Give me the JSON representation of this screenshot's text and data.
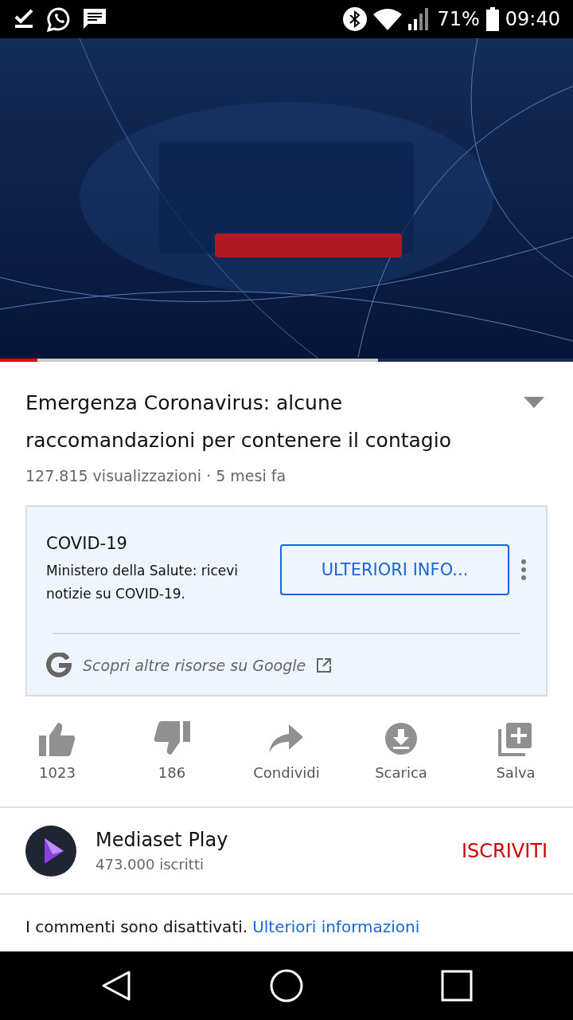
{
  "status_bar": {
    "battery_text": "71%",
    "time": "09:40"
  },
  "video": {
    "kind": "picture",
    "progress": {
      "level": 0.065
    },
    "buffer": {
      "level": 0.66
    }
  },
  "title": "Emergenza Coronavirus: alcune raccomandazioni per contenere il contagio",
  "meta": "127.815 visualizzazioni · 5 mesi fa",
  "info_card": {
    "heading": "COVID-19",
    "text": "Ministero della Salute: ricevi notizie su COVID-19.",
    "button": "ULTERIORI INFO...",
    "link": "Scopri altre risorse su Google"
  },
  "actions": [
    {
      "kind": "like",
      "label": "1023"
    },
    {
      "kind": "dislike",
      "label": "186"
    },
    {
      "kind": "share",
      "label": "Condividi"
    },
    {
      "kind": "download",
      "label": "Scarica"
    },
    {
      "kind": "save",
      "label": "Salva"
    }
  ],
  "channel": {
    "name": "Mediaset Play",
    "subscribers": "473.000 iscritti",
    "subscribe": "ISCRIVITI"
  },
  "comments": {
    "text": "I commenti sono disattivati.",
    "link": "Ulteriori informazioni"
  }
}
